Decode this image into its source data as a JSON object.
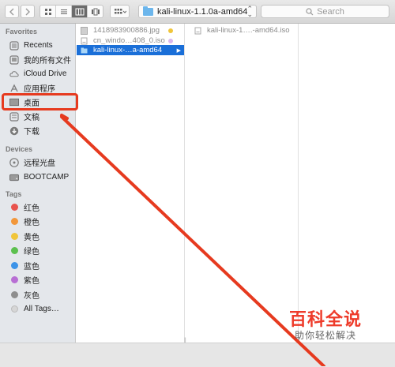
{
  "toolbar": {
    "path": "kali-linux-1.1.0a-amd64",
    "search_placeholder": "Search"
  },
  "sidebar": {
    "favorites_title": "Favorites",
    "favorites": [
      {
        "label": "Recents",
        "icon": "recents-icon"
      },
      {
        "label": "我的所有文件",
        "icon": "all-files-icon"
      },
      {
        "label": "iCloud Drive",
        "icon": "icloud-icon"
      },
      {
        "label": "应用程序",
        "icon": "applications-icon"
      },
      {
        "label": "桌面",
        "icon": "desktop-icon"
      },
      {
        "label": "文稿",
        "icon": "documents-icon"
      },
      {
        "label": "下载",
        "icon": "downloads-icon"
      }
    ],
    "devices_title": "Devices",
    "devices": [
      {
        "label": "远程光盘",
        "icon": "remote-disc-icon"
      },
      {
        "label": "BOOTCAMP",
        "icon": "drive-icon"
      }
    ],
    "tags_title": "Tags",
    "tags": [
      {
        "label": "红色",
        "color": "#e8534d"
      },
      {
        "label": "橙色",
        "color": "#f2973a"
      },
      {
        "label": "黄色",
        "color": "#f0c53a"
      },
      {
        "label": "绿色",
        "color": "#5cc04e"
      },
      {
        "label": "蓝色",
        "color": "#3c93e8"
      },
      {
        "label": "紫色",
        "color": "#b86fd4"
      },
      {
        "label": "灰色",
        "color": "#8e8e8e"
      },
      {
        "label": "All Tags…",
        "color": "#d6d6d6"
      }
    ]
  },
  "column1": {
    "files": [
      {
        "name": "1418983900886.jpg",
        "tag": "#f0c53a"
      },
      {
        "name": "cn_windo…408_0.iso",
        "tag": "#d9b7ef"
      },
      {
        "name": "kali-linux-…a-amd64",
        "selected": true
      }
    ]
  },
  "column2": {
    "files": [
      {
        "name": "kali-linux-1….-amd64.iso"
      }
    ]
  },
  "watermark": {
    "title": "百科全说",
    "subtitle": "助你轻松解决"
  }
}
